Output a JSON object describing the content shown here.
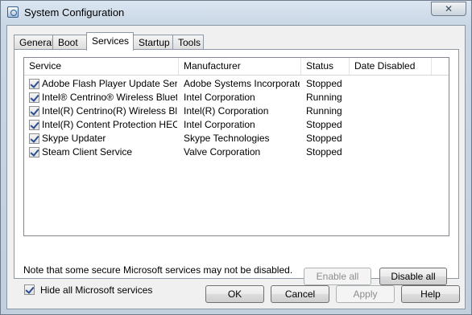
{
  "window": {
    "title": "System Configuration",
    "close_label": "✕"
  },
  "tabs": [
    {
      "label": "General"
    },
    {
      "label": "Boot"
    },
    {
      "label": "Services"
    },
    {
      "label": "Startup"
    },
    {
      "label": "Tools"
    }
  ],
  "columns": {
    "service": "Service",
    "manufacturer": "Manufacturer",
    "status": "Status",
    "date_disabled": "Date Disabled"
  },
  "services": [
    {
      "checked": true,
      "service": "Adobe Flash Player Update Service",
      "manufacturer": "Adobe Systems Incorporated",
      "status": "Stopped",
      "date_disabled": ""
    },
    {
      "checked": true,
      "service": "Intel® Centrino® Wireless Bluet...",
      "manufacturer": "Intel Corporation",
      "status": "Running",
      "date_disabled": ""
    },
    {
      "checked": true,
      "service": "Intel(R) Centrino(R) Wireless Blu...",
      "manufacturer": "Intel(R) Corporation",
      "status": "Running",
      "date_disabled": ""
    },
    {
      "checked": true,
      "service": "Intel(R) Content Protection HEC...",
      "manufacturer": "Intel Corporation",
      "status": "Stopped",
      "date_disabled": ""
    },
    {
      "checked": true,
      "service": "Skype Updater",
      "manufacturer": "Skype Technologies",
      "status": "Stopped",
      "date_disabled": ""
    },
    {
      "checked": true,
      "service": "Steam Client Service",
      "manufacturer": "Valve Corporation",
      "status": "Stopped",
      "date_disabled": ""
    }
  ],
  "note": "Note that some secure Microsoft services may not be disabled.",
  "buttons": {
    "enable_all": "Enable all",
    "disable_all": "Disable all",
    "ok": "OK",
    "cancel": "Cancel",
    "apply": "Apply",
    "help": "Help"
  },
  "hide_ms": {
    "label": "Hide all Microsoft services",
    "checked": true
  }
}
